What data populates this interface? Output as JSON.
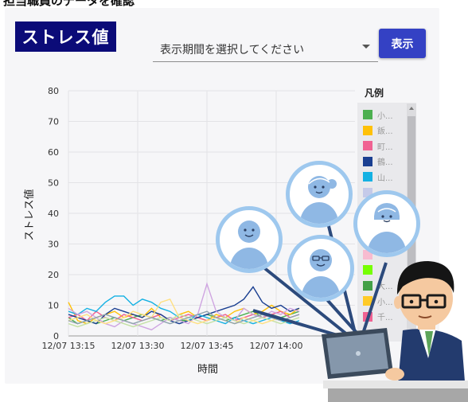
{
  "page": {
    "heading": "担当職員のデータを確認"
  },
  "header": {
    "title": "ストレス値",
    "period_select": {
      "value": "表示期間を選択してください"
    },
    "show_button": "表示"
  },
  "chart_data": {
    "type": "line",
    "title": "",
    "xlabel": "時間",
    "ylabel": "ストレス値",
    "ylim": [
      0,
      80
    ],
    "ytick_labels": [
      "0",
      "10",
      "20",
      "30",
      "40",
      "50",
      "60",
      "70",
      "80"
    ],
    "x_tick_labels": [
      "12/07 13:15",
      "12/07 13:30",
      "12/07 13:45",
      "12/07 14:00"
    ],
    "x": [
      "13:15",
      "13:17",
      "13:19",
      "13:21",
      "13:23",
      "13:25",
      "13:27",
      "13:29",
      "13:31",
      "13:33",
      "13:35",
      "13:37",
      "13:39",
      "13:41",
      "13:43",
      "13:45",
      "13:47",
      "13:49",
      "13:51",
      "13:53",
      "13:55",
      "13:57",
      "13:59",
      "14:01",
      "14:03",
      "14:05"
    ],
    "series": [
      {
        "color": "#4caf50",
        "values": [
          6,
          4,
          5,
          4,
          5,
          6,
          5,
          6,
          7,
          6,
          5,
          6,
          5,
          5,
          6,
          7,
          6,
          5,
          6,
          7,
          8,
          6,
          7,
          6,
          7,
          8
        ]
      },
      {
        "color": "#ffc107",
        "values": [
          11,
          5,
          4,
          6,
          7,
          8,
          6,
          7,
          6,
          9,
          6,
          5,
          7,
          8,
          6,
          5,
          7,
          6,
          8,
          9,
          7,
          8,
          10,
          8,
          7,
          9
        ]
      },
      {
        "color": "#f06292",
        "values": [
          6,
          7,
          5,
          8,
          6,
          5,
          7,
          6,
          5,
          6,
          7,
          5,
          6,
          7,
          6,
          5,
          6,
          7,
          5,
          6,
          7,
          6,
          7,
          8,
          6,
          7
        ]
      },
      {
        "color": "#1a3f91",
        "values": [
          7,
          6,
          5,
          4,
          7,
          9,
          8,
          7,
          6,
          8,
          7,
          5,
          4,
          5,
          6,
          7,
          8,
          9,
          10,
          12,
          16,
          11,
          9,
          10,
          8,
          9
        ]
      },
      {
        "color": "#14b1e3",
        "values": [
          8,
          7,
          9,
          8,
          11,
          13,
          13,
          10,
          12,
          11,
          9,
          8,
          6,
          5,
          7,
          6,
          5,
          4,
          6,
          5,
          4,
          5,
          6,
          5,
          4,
          5
        ]
      },
      {
        "color": "#cfa5e1",
        "values": [
          9,
          7,
          8,
          6,
          4,
          3,
          5,
          4,
          3,
          2,
          4,
          6,
          5,
          4,
          7,
          17,
          8,
          6,
          5,
          9,
          7,
          6,
          8,
          7,
          9,
          8
        ]
      },
      {
        "color": "#c5e1a5",
        "values": [
          4,
          3,
          4,
          5,
          6,
          5,
          4,
          3,
          4,
          5,
          6,
          5,
          7,
          6,
          5,
          4,
          5,
          6,
          5,
          4,
          5,
          6,
          5,
          4,
          5,
          6
        ]
      },
      {
        "color": "#ffe082",
        "values": [
          5,
          6,
          7,
          5,
          4,
          5,
          6,
          8,
          7,
          6,
          11,
          12,
          6,
          5,
          4,
          5,
          6,
          5,
          4,
          6,
          5,
          4,
          5,
          6,
          5,
          4
        ]
      },
      {
        "color": "#90a4ae",
        "values": [
          5,
          4,
          5,
          6,
          7,
          6,
          5,
          4,
          5,
          6,
          5,
          4,
          5,
          6,
          7,
          8,
          6,
          5,
          4,
          5,
          6,
          7,
          6,
          5,
          6,
          7
        ]
      }
    ]
  },
  "legend": {
    "title": "凡例",
    "items": [
      {
        "label": "小...",
        "color": "#4caf50"
      },
      {
        "label": "飯...",
        "color": "#ffc107"
      },
      {
        "label": "町...",
        "color": "#f06292"
      },
      {
        "label": "鶴...",
        "color": "#1a3f91"
      },
      {
        "label": "山...",
        "color": "#14b1e3"
      },
      {
        "label": "",
        "color": "#c5cae9"
      },
      {
        "label": "",
        "color": "#d1c4e9"
      },
      {
        "label": "",
        "color": "#bbdefb"
      },
      {
        "label": "",
        "color": "#ffccbc"
      },
      {
        "label": "",
        "color": "#f8bbd0"
      },
      {
        "label": "",
        "color": "#76ff03"
      },
      {
        "label": "大...",
        "color": "#43a047"
      },
      {
        "label": "小...",
        "color": "#ffca28"
      },
      {
        "label": "千...",
        "color": "#f06292"
      }
    ]
  },
  "colors": {
    "title_badge": "#0b0b78",
    "show_button": "#3441c4",
    "avatar_ring": "#9ec8ee",
    "avatar_fill": "#8fb8e4",
    "connector": "#2c4a7c"
  }
}
